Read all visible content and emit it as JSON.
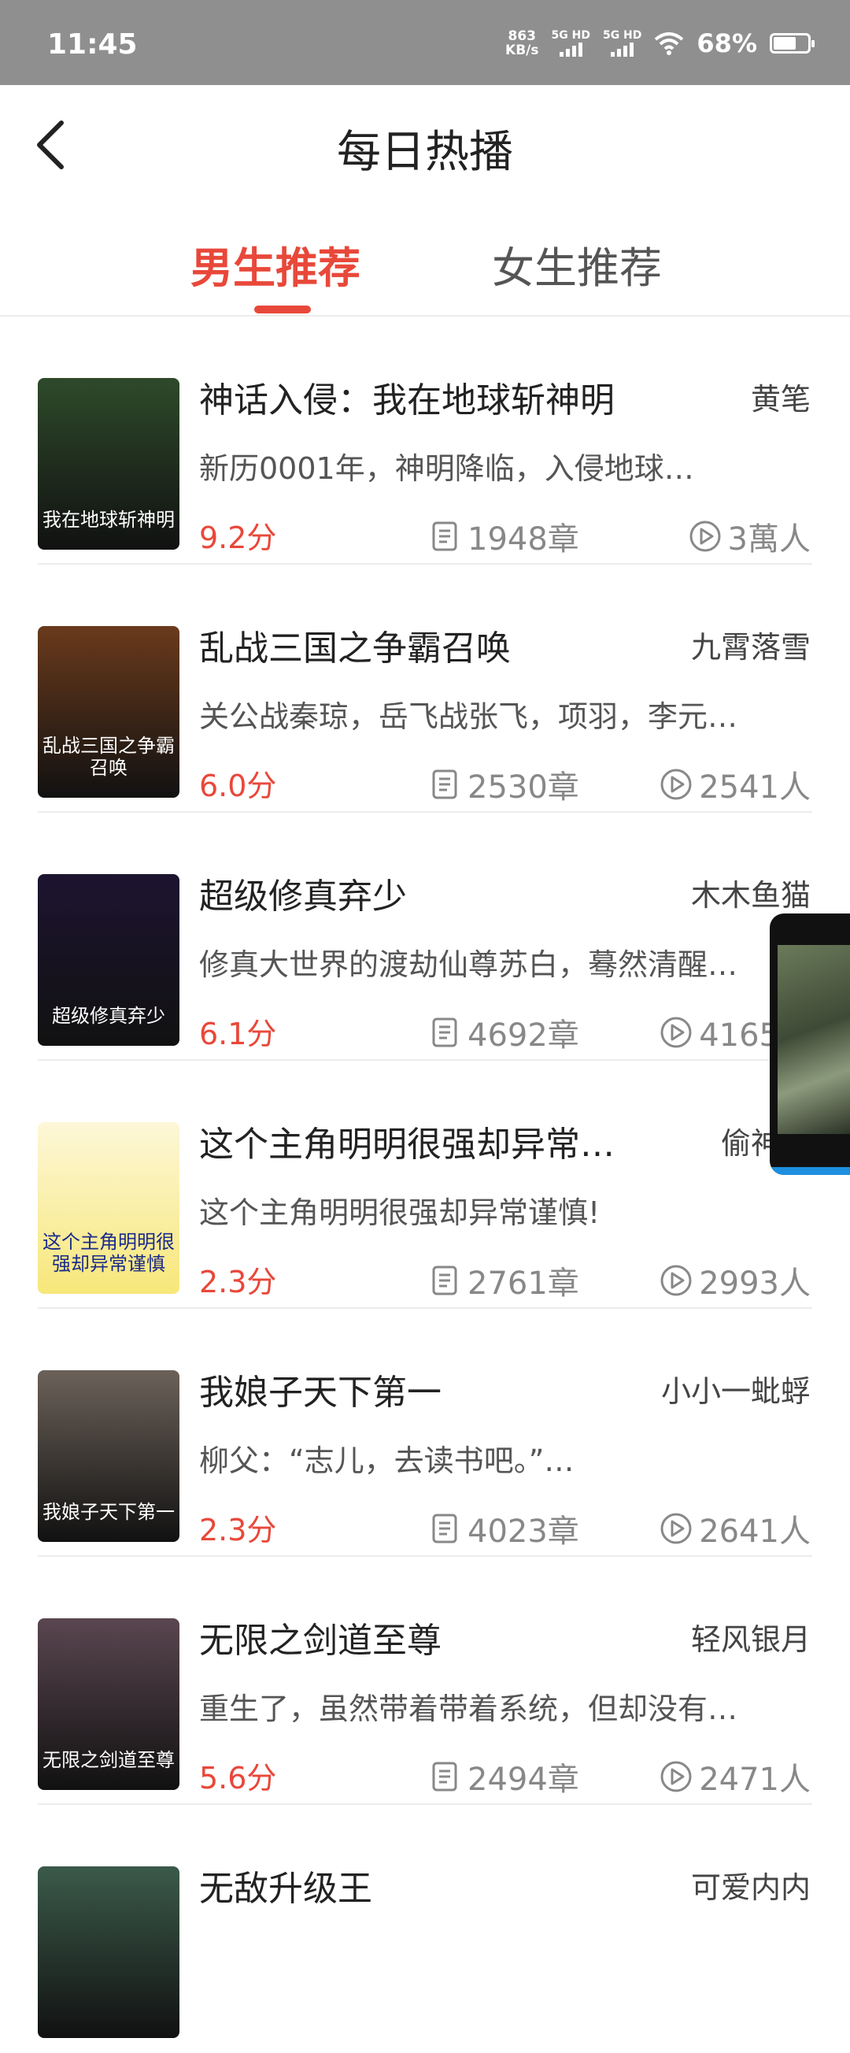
{
  "status": {
    "time": "11:45",
    "net_speed_top": "863",
    "net_speed_bottom": "KB/s",
    "sim1": "5G HD",
    "sim2": "5G HD",
    "battery": "68%"
  },
  "header": {
    "title": "每日热播"
  },
  "tabs": [
    {
      "label": "男生推荐",
      "active": true
    },
    {
      "label": "女生推荐",
      "active": false
    }
  ],
  "books": [
    {
      "title": "神话入侵：我在地球斩神明",
      "author": "黄笔",
      "desc": "新历0001年，神明降临，入侵地球…",
      "score": "9.2分",
      "chapters": "1948章",
      "readers": "3萬人",
      "cover_text": "我在地球斩神明",
      "cover_color": "#2e4a2a"
    },
    {
      "title": "乱战三国之争霸召唤",
      "author": "九霄落雪",
      "desc": "关公战秦琼，岳飞战张飞，项羽，李元…",
      "score": "6.0分",
      "chapters": "2530章",
      "readers": "2541人",
      "cover_text": "乱战三国之争霸召唤",
      "cover_color": "#6a3a1c"
    },
    {
      "title": "超级修真弃少",
      "author": "木木鱼猫",
      "desc": "修真大世界的渡劫仙尊苏白，蓦然清醒…",
      "score": "6.1分",
      "chapters": "4692章",
      "readers": "4165人",
      "cover_text": "超级修真弃少",
      "cover_color": "#1d1430"
    },
    {
      "title": "这个主角明明很强却异常…",
      "author": "偷神月",
      "desc": "这个主角明明很强却异常谨慎!",
      "score": "2.3分",
      "chapters": "2761章",
      "readers": "2993人",
      "cover_text": "这个主角明明很强却异常谨慎",
      "cover_color": "#fdf7d8"
    },
    {
      "title": "我娘子天下第一",
      "author": "小小一蚍蜉",
      "desc": "柳父：“志儿，去读书吧。”…",
      "score": "2.3分",
      "chapters": "4023章",
      "readers": "2641人",
      "cover_text": "我娘子天下第一",
      "cover_color": "#6b6159"
    },
    {
      "title": "无限之剑道至尊",
      "author": "轻风银月",
      "desc": "重生了，虽然带着带着系统，但却没有…",
      "score": "5.6分",
      "chapters": "2494章",
      "readers": "2471人",
      "cover_text": "无限之剑道至尊",
      "cover_color": "#5a4650"
    },
    {
      "title": "无敌升级王",
      "author": "可爱内内",
      "desc": "",
      "score": "",
      "chapters": "",
      "readers": "",
      "cover_text": "",
      "cover_color": "#3b5a4a"
    }
  ]
}
